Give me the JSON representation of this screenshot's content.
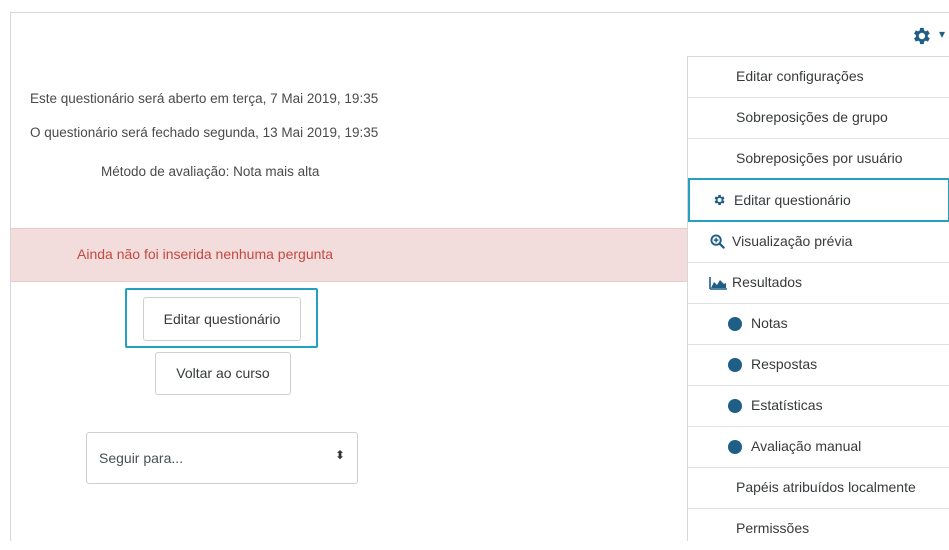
{
  "info": {
    "open": "Este questionário será aberto em terça, 7 Mai 2019, 19:35",
    "close": "O questionário será fechado segunda, 13 Mai 2019, 19:35",
    "method": "Método de avaliação: Nota mais alta"
  },
  "alert": "Ainda não foi inserida nenhuma pergunta",
  "buttons": {
    "edit_quiz": "Editar questionário",
    "back_course": "Voltar ao curso"
  },
  "jump": {
    "selected": "Seguir para..."
  },
  "menu": {
    "items": [
      {
        "label": "Editar configurações",
        "icon": ""
      },
      {
        "label": "Sobreposições de grupo",
        "icon": ""
      },
      {
        "label": "Sobreposições por usuário",
        "icon": ""
      },
      {
        "label": "Editar questionário",
        "icon": "gear-icon"
      },
      {
        "label": "Visualização prévia",
        "icon": "zoom-in-icon"
      },
      {
        "label": "Resultados",
        "icon": "area-chart-icon"
      },
      {
        "label": "Notas",
        "icon": "circle-icon"
      },
      {
        "label": "Respostas",
        "icon": "circle-icon"
      },
      {
        "label": "Estatísticas",
        "icon": "circle-icon"
      },
      {
        "label": "Avaliação manual",
        "icon": "circle-icon"
      },
      {
        "label": "Papéis atribuídos localmente",
        "icon": ""
      },
      {
        "label": "Permissões",
        "icon": ""
      }
    ]
  },
  "colors": {
    "accent": "#23a0c0",
    "alert_bg": "#f3dcdc",
    "alert_text": "#c34a43",
    "icon_blue": "#1f5f85"
  }
}
